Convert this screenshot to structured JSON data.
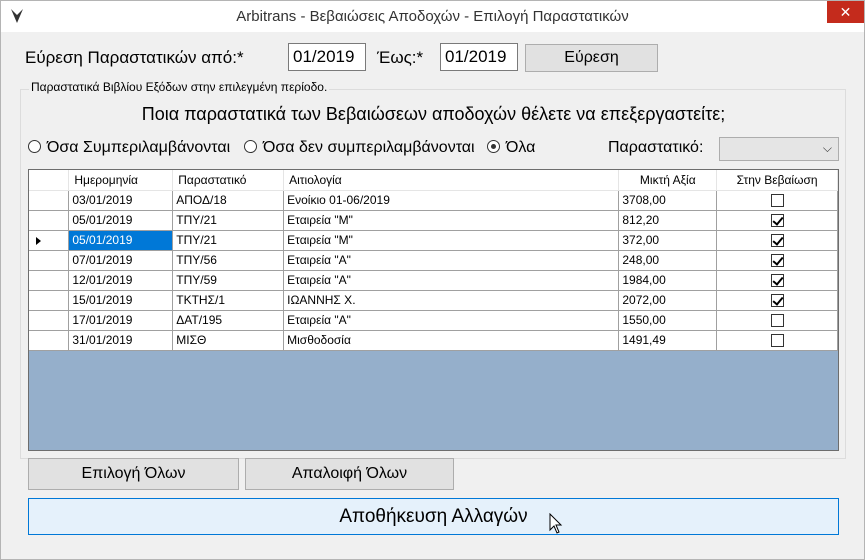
{
  "window": {
    "title": "Arbitrans - Βεβαιώσεις Αποδοχών - Επιλογή Παραστατικών",
    "close_glyph": "✕"
  },
  "search": {
    "from_label": "Εύρεση Παραστατικών από:*",
    "from_value": "01/2019",
    "to_label": "Έως:*",
    "to_value": "01/2019",
    "button": "Εύρεση"
  },
  "group": {
    "label": "Παραστατικά Βιβλίου Εξόδων στην επιλεγμένη περίοδο.",
    "question": "Ποια παραστατικά των Βεβαιώσεων αποδοχών θέλετε να επεξεργαστείτε;"
  },
  "filter": {
    "options": [
      "Όσα Συμπεριλαμβάνονται",
      "Όσα δεν συμπεριλαμβάνονται",
      "Όλα"
    ],
    "selected_index": 2,
    "doc_label": "Παραστατικό:",
    "doc_value": ""
  },
  "grid": {
    "columns": [
      "Ημερομηνία",
      "Παραστατικό",
      "Αιτιολογία",
      "Μικτή Αξία",
      "Στην Βεβαίωση"
    ],
    "current_row": 2,
    "rows": [
      {
        "date": "03/01/2019",
        "doc": "ΑΠΟΔ/18",
        "reason": "Ενοίκιο 01-06/2019",
        "amount": "3708,00",
        "checked": false
      },
      {
        "date": "05/01/2019",
        "doc": "ΤΠΥ/21",
        "reason": "Εταιρεία \"Μ\"",
        "amount": "812,20",
        "checked": true
      },
      {
        "date": "05/01/2019",
        "doc": "ΤΠΥ/21",
        "reason": "Εταιρεία \"Μ\"",
        "amount": "372,00",
        "checked": true
      },
      {
        "date": "07/01/2019",
        "doc": "ΤΠΥ/56",
        "reason": "Εταιρεία \"Α\"",
        "amount": "248,00",
        "checked": true
      },
      {
        "date": "12/01/2019",
        "doc": "ΤΠΥ/59",
        "reason": "Εταιρεία \"Α\"",
        "amount": "1984,00",
        "checked": true
      },
      {
        "date": "15/01/2019",
        "doc": "ΤΚΤΗΣ/1",
        "reason": "ΙΩΑΝΝΗΣ Χ.",
        "amount": "2072,00",
        "checked": true
      },
      {
        "date": "17/01/2019",
        "doc": "ΔΑΤ/195",
        "reason": "Εταιρεία \"Α\"",
        "amount": "1550,00",
        "checked": false
      },
      {
        "date": "31/01/2019",
        "doc": "ΜΙΣΘ",
        "reason": "Μισθοδοσία",
        "amount": "1491,49",
        "checked": false
      }
    ]
  },
  "actions": {
    "select_all": "Επιλογή Όλων",
    "clear_all": "Απαλοιφή Όλων",
    "save": "Αποθήκευση Αλλαγών"
  },
  "colors": {
    "grid_background": "#95afcb",
    "selection": "#0078d7",
    "close_button": "#c42b1c"
  }
}
